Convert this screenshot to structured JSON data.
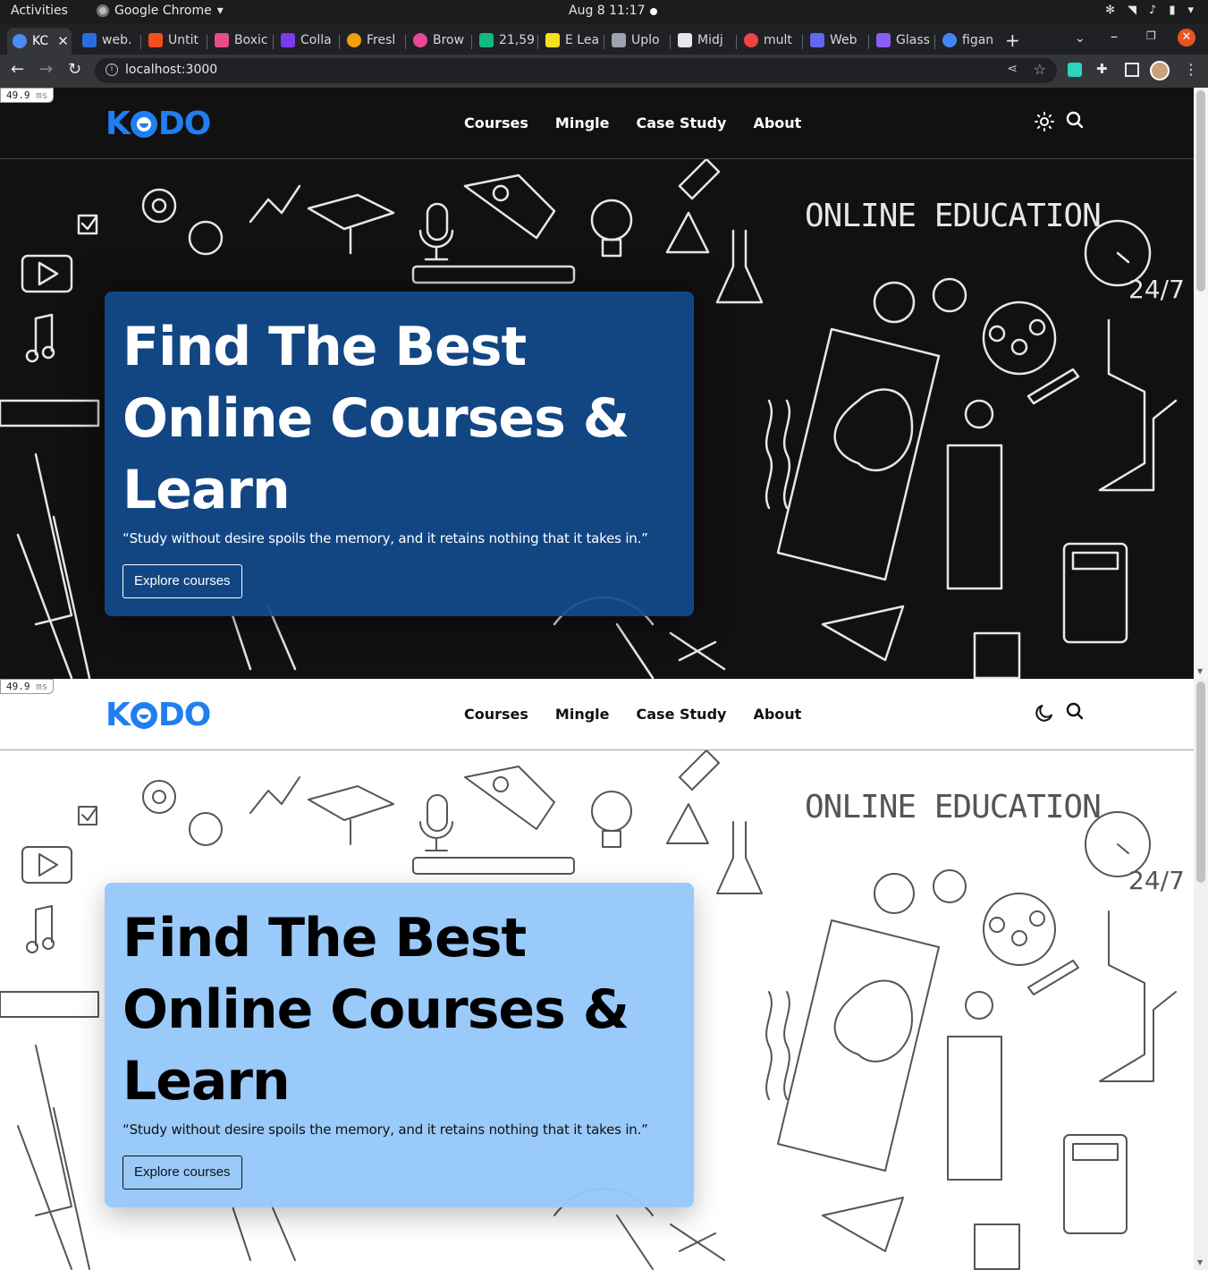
{
  "os": {
    "activities": "Activities",
    "app_name": "Google Chrome",
    "clock": "Aug 8  11:17"
  },
  "tabs": [
    {
      "label": "KC",
      "color": "#4a8cf0"
    },
    {
      "label": "web.",
      "color": "#2b6de0"
    },
    {
      "label": "Untit",
      "color": "#f24e1e"
    },
    {
      "label": "Boxic",
      "color": "#e94c89"
    },
    {
      "label": "Colla",
      "color": "#7c3aed"
    },
    {
      "label": "Fresl",
      "color": "#f59e0b"
    },
    {
      "label": "Brow",
      "color": "#ec4899"
    },
    {
      "label": "21,59",
      "color": "#10b981"
    },
    {
      "label": "E Lea",
      "color": "#f7df1e"
    },
    {
      "label": "Uplo",
      "color": "#9ca3af"
    },
    {
      "label": "Midj",
      "color": "#e5e7eb"
    },
    {
      "label": "mult",
      "color": "#ef4444"
    },
    {
      "label": "Web",
      "color": "#6366f1"
    },
    {
      "label": "Glass",
      "color": "#8b5cf6"
    },
    {
      "label": "figan",
      "color": "#4285f4"
    }
  ],
  "address": {
    "url": "localhost:3000"
  },
  "perf": {
    "value": "49.9",
    "unit": "ms"
  },
  "site": {
    "logo": "KODO",
    "logo_parts": {
      "k": "K",
      "do": "DO"
    },
    "nav": [
      "Courses",
      "Mingle",
      "Case Study",
      "About"
    ],
    "hero": {
      "title_line1": "Find The Best",
      "title_line2": "Online Courses &",
      "title_line3": "Learn",
      "quote": "“Study without desire spoils the memory, and it retains nothing that it takes in.”",
      "cta": "Explore courses",
      "art_heading": "ONLINE EDUCATION",
      "art_247": "24/7"
    }
  },
  "themes": {
    "dark": {
      "toggle_icon": "sun-icon"
    },
    "light": {
      "toggle_icon": "moon-icon"
    }
  },
  "colors": {
    "brand": "#1f7ff0",
    "dark_card": "#124a8c",
    "light_card": "#96c8fa"
  }
}
